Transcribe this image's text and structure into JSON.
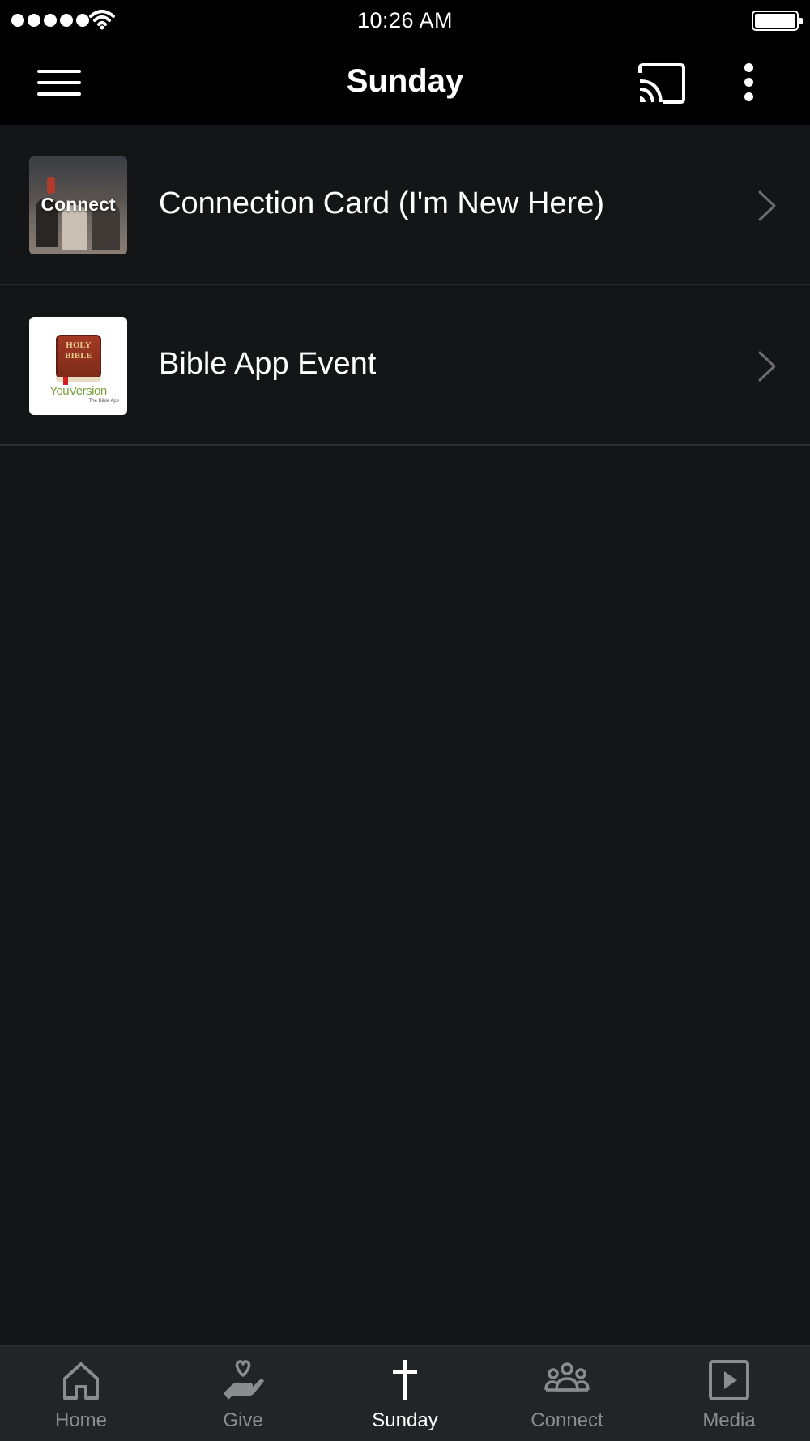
{
  "status_bar": {
    "time": "10:26 AM"
  },
  "nav": {
    "title": "Sunday",
    "menu_icon": "hamburger-menu-icon",
    "cast_icon": "cast-icon",
    "more_icon": "more-vertical-icon"
  },
  "items": [
    {
      "title": "Connection Card (I'm New Here)",
      "thumb_label": "Connect"
    },
    {
      "title": "Bible App Event",
      "thumb_book_line1": "HOLY",
      "thumb_book_line2": "BIBLE",
      "thumb_brand": "YouVersion",
      "thumb_brand_sub": "The Bible App"
    }
  ],
  "tabs": [
    {
      "label": "Home",
      "icon": "home-icon"
    },
    {
      "label": "Give",
      "icon": "give-hand-heart-icon"
    },
    {
      "label": "Sunday",
      "icon": "cross-icon",
      "active": true
    },
    {
      "label": "Connect",
      "icon": "people-group-icon"
    },
    {
      "label": "Media",
      "icon": "play-square-icon"
    }
  ],
  "colors": {
    "background": "#141517",
    "header": "#000000",
    "tab_bar": "#232427",
    "tab_inactive": "#8b8c8f",
    "tab_active": "#ffffff"
  }
}
